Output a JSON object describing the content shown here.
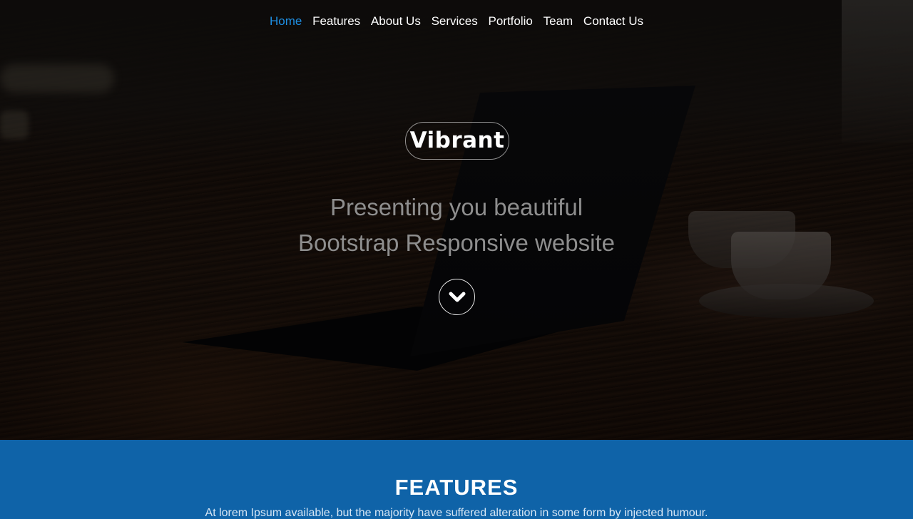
{
  "nav": {
    "items": [
      {
        "label": "Home",
        "active": true
      },
      {
        "label": "Features",
        "active": false
      },
      {
        "label": "About Us",
        "active": false
      },
      {
        "label": "Services",
        "active": false
      },
      {
        "label": "Portfolio",
        "active": false
      },
      {
        "label": "Team",
        "active": false
      },
      {
        "label": "Contact Us",
        "active": false
      }
    ]
  },
  "hero": {
    "brand": "Vibrant",
    "tagline_line1": "Presenting you beautiful",
    "tagline_line2": "Bootstrap Responsive website",
    "scroll_icon": "chevron-down-icon"
  },
  "features": {
    "title": "FEATURES",
    "description": "At lorem Ipsum available, but the majority have suffered alteration in some form by injected humour."
  },
  "colors": {
    "nav_active": "#1e8fe3",
    "features_bg": "#0f63a8",
    "tagline": "#8e8e8e"
  }
}
